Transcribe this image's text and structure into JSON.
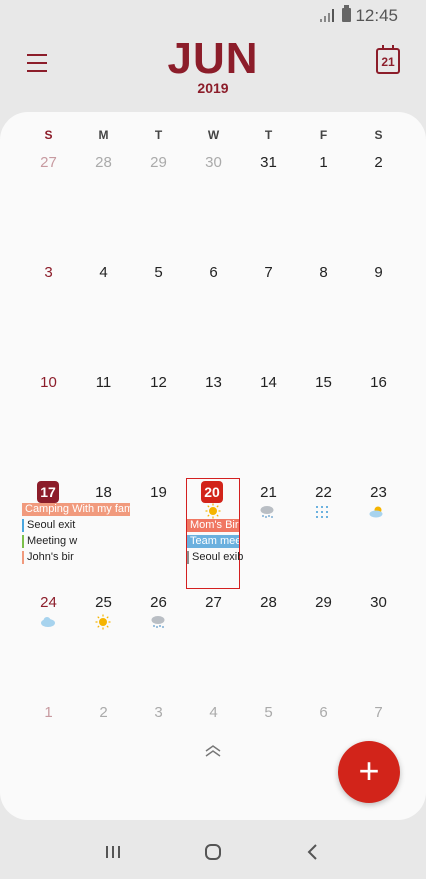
{
  "status_bar": {
    "time": "12:45"
  },
  "header": {
    "month": "JUN",
    "year": "2019",
    "today_icon_day": "21"
  },
  "weekdays": [
    "S",
    "M",
    "T",
    "W",
    "T",
    "F",
    "S"
  ],
  "weeks": [
    [
      "27",
      "28",
      "29",
      "30",
      "31",
      "1",
      "2"
    ],
    [
      "3",
      "4",
      "5",
      "6",
      "7",
      "8",
      "9"
    ],
    [
      "10",
      "11",
      "12",
      "13",
      "14",
      "15",
      "16"
    ],
    [
      "17",
      "18",
      "19",
      "20",
      "21",
      "22",
      "23"
    ],
    [
      "24",
      "25",
      "26",
      "27",
      "28",
      "29",
      "30"
    ],
    [
      "1",
      "2",
      "3",
      "4",
      "5",
      "6",
      "7"
    ]
  ],
  "events": {
    "camping": "Camping With my fam",
    "seoul_exit": "Seoul exit",
    "meeting": "Meeting w",
    "johns": "John's bir",
    "moms": "Mom's Bir",
    "team": "Team mee",
    "seoul_exib": "Seoul exib"
  },
  "weather_icons": {
    "20": "sun-icon",
    "21": "snow-cloud-icon",
    "22": "rain-icon",
    "23": "sun-cloud-icon",
    "24": "cloud-icon",
    "25": "sun-icon",
    "26": "snow-cloud-icon"
  },
  "colors": {
    "brand": "#8c1d2a",
    "today": "#d2241a",
    "camping_bar": "#f19a7d",
    "moms_bar": "#f07762",
    "team_bar": "#6bb0de",
    "seoul_exit_line": "#4aa7df",
    "meeting_line": "#7cc04a",
    "johns_line": "#f19a7d"
  }
}
